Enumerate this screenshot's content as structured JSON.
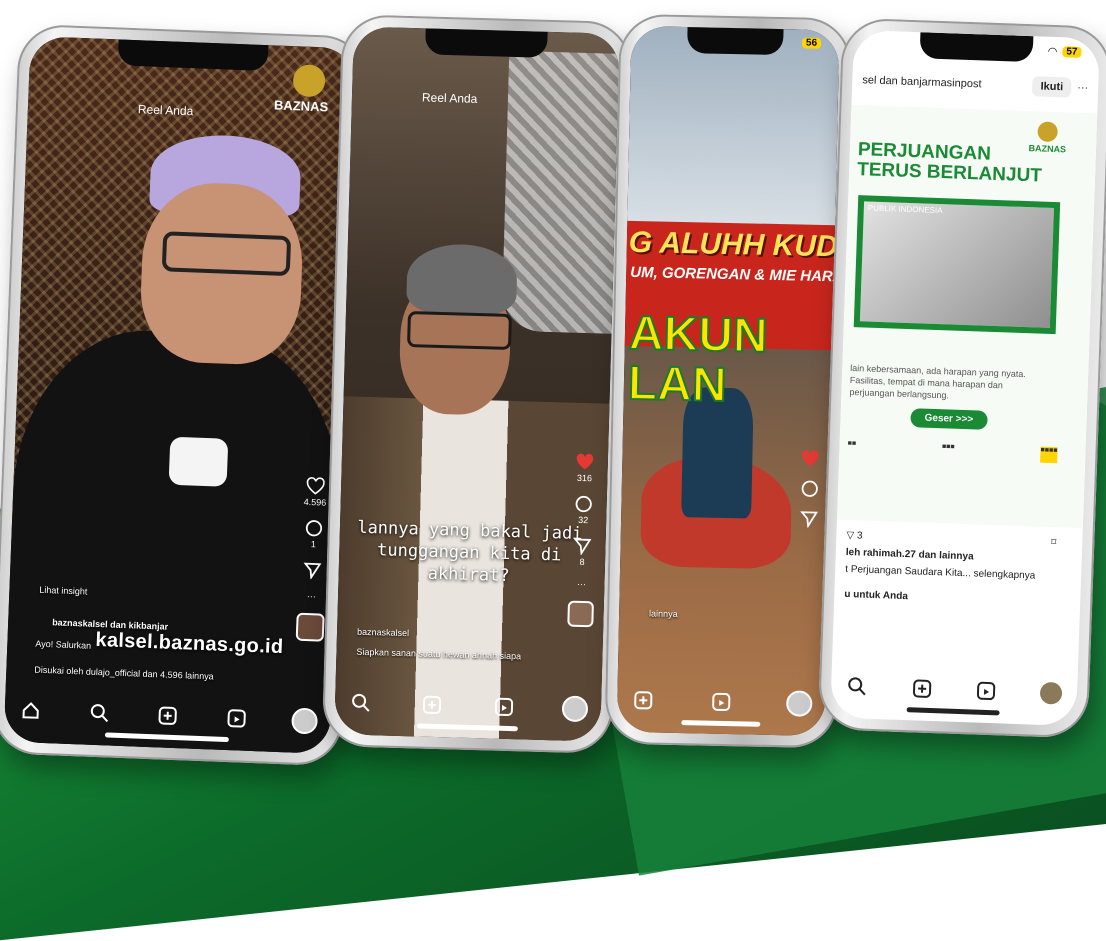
{
  "phone1": {
    "reel_title": "Reel Anda",
    "brand": "BAZNAS",
    "watermark": "kalsel.baznas.go.id",
    "insight": "Lihat insight",
    "author": "baznaskalsel dan kikbanjar",
    "caption": "Ayo! Salurkan",
    "likes_line": "Disukai oleh dulajo_official dan 4.596 lainnya",
    "like_count": "4.596",
    "comment_count": "1"
  },
  "phone2": {
    "reel_title": "Reel Anda",
    "caption_line1": "lannya yang bakal jadi",
    "caption_line2": "tunggangan kita di",
    "caption_line3": "akhirat?",
    "like_count": "316",
    "comment_count": "32",
    "share_count": "8",
    "author": "baznaskalsel",
    "sub": "Siapkan sanan suatu hewan ahnah siapa"
  },
  "phone3": {
    "battery": "56",
    "banner_line1": "G ALUHH KUDA",
    "banner_line2": "UM, GORENGAN & MIE HARA",
    "big_line1": "AKUN",
    "big_line2": "LAN",
    "likes": "lainnya"
  },
  "phone4": {
    "battery": "57",
    "header_text": "sel dan banjarmasinpost",
    "follow": "Ikuti",
    "logo": "BAZNAS",
    "headline_line1": "PERJUANGAN",
    "headline_line2": "TERUS BERLANJUT",
    "photo_label": "PUBLIK INDONESIA",
    "desc": "lain kebersamaan, ada harapan yang nyata. Fasilitas, tempat di mana harapan dan perjuangan berlangsung.",
    "geser": "Geser >>>",
    "share_count": "3",
    "liked_by": "leh rahimah.27 dan lainnya",
    "caption": "t Perjuangan Saudara Kita... selengkapnya",
    "for_you": "u untuk Anda"
  },
  "colors": {
    "brand_green": "#1b8a34",
    "heart_red": "#e53935"
  }
}
